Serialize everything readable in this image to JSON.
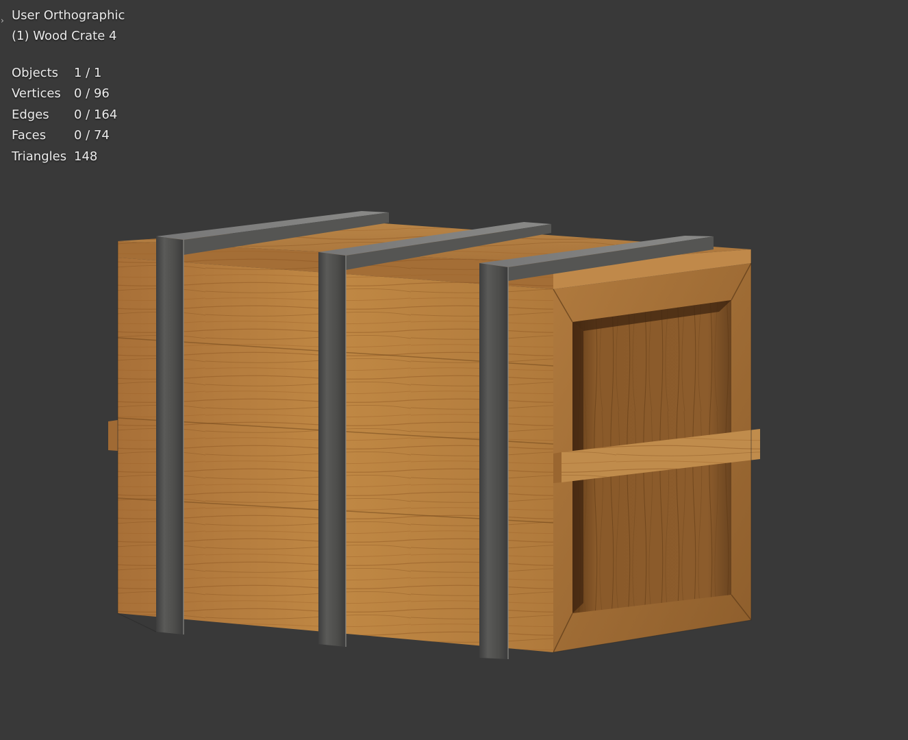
{
  "viewport": {
    "view_name": "User Orthographic",
    "object_name": "(1) Wood Crate 4",
    "panel_toggle_icon": "chevron-right-icon",
    "stats": [
      {
        "label": "Objects",
        "value": "1 / 1"
      },
      {
        "label": "Vertices",
        "value": "0 / 96"
      },
      {
        "label": "Edges",
        "value": "0 / 164"
      },
      {
        "label": "Faces",
        "value": "0 / 74"
      },
      {
        "label": "Triangles",
        "value": "148"
      }
    ]
  },
  "colors": {
    "background": "#393939",
    "overlay_text": "#ececec",
    "wood_light": "#b7803f",
    "wood_dark": "#8a5a26",
    "metal_band": "#4a4a4a"
  }
}
